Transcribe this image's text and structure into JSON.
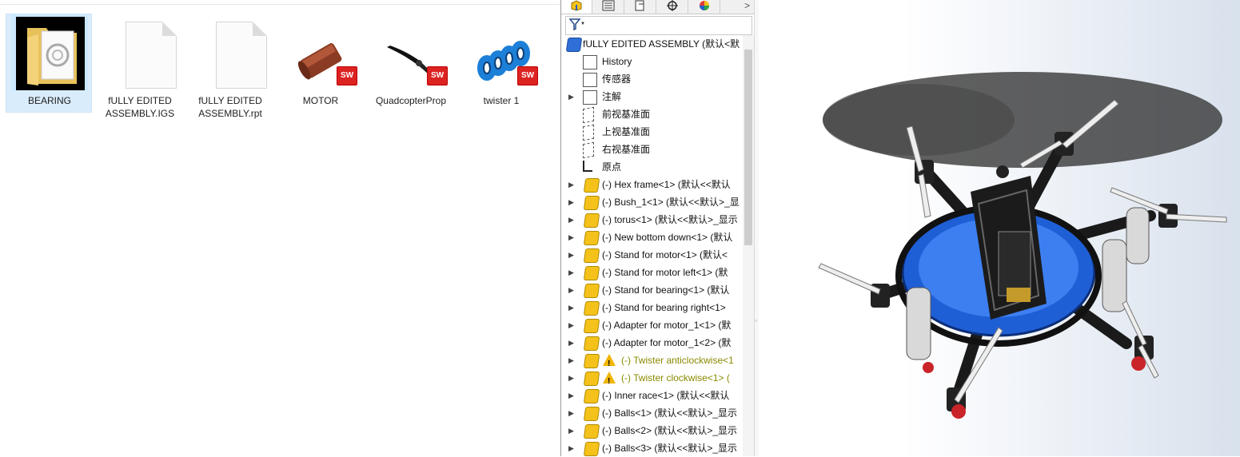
{
  "explorer": {
    "files": [
      {
        "name": "BEARING",
        "type": "folder"
      },
      {
        "name": "fULLY EDITED ASSEMBLY.IGS",
        "type": "document"
      },
      {
        "name": "fULLY EDITED ASSEMBLY.rpt",
        "type": "document"
      },
      {
        "name": "MOTOR",
        "type": "solidworks-part"
      },
      {
        "name": "QuadcopterProp",
        "type": "solidworks-part"
      },
      {
        "name": "twister 1",
        "type": "solidworks-part"
      }
    ],
    "sw_badge": "SW"
  },
  "feature_manager": {
    "tabs": [
      "featuremanager-icon",
      "propertymanager-icon",
      "configurationmanager-icon",
      "dimxpert-icon",
      "display-manager-icon"
    ],
    "more_glyph": ">",
    "filter_glyph": "▼",
    "root": "fULLY EDITED ASSEMBLY  (默认<默",
    "nodes": [
      {
        "label": "History",
        "icon": "history-icon",
        "expandable": false
      },
      {
        "label": "传感器",
        "icon": "sensor-icon",
        "expandable": false
      },
      {
        "label": "注解",
        "icon": "annotation-icon",
        "expandable": true
      },
      {
        "label": "前视基准面",
        "icon": "plane-icon",
        "expandable": false
      },
      {
        "label": "上视基准面",
        "icon": "plane-icon",
        "expandable": false
      },
      {
        "label": "右视基准面",
        "icon": "plane-icon",
        "expandable": false
      },
      {
        "label": "原点",
        "icon": "origin-icon",
        "expandable": false
      },
      {
        "label": "(-) Hex frame<1> (默认<<默认",
        "icon": "part-icon",
        "expandable": true
      },
      {
        "label": "(-) Bush_1<1> (默认<<默认>_显",
        "icon": "part-icon",
        "expandable": true
      },
      {
        "label": "(-) torus<1> (默认<<默认>_显示",
        "icon": "part-icon",
        "expandable": true
      },
      {
        "label": "(-) New bottom down<1> (默认",
        "icon": "part-icon",
        "expandable": true
      },
      {
        "label": "(-) Stand for motor<1> (默认<",
        "icon": "part-icon",
        "expandable": true
      },
      {
        "label": "(-) Stand for motor left<1> (默",
        "icon": "part-icon",
        "expandable": true
      },
      {
        "label": "(-) Stand for bearing<1> (默认",
        "icon": "part-icon",
        "expandable": true
      },
      {
        "label": "(-) Stand for bearing right<1>",
        "icon": "part-icon",
        "expandable": true
      },
      {
        "label": "(-) Adapter for motor_1<1> (默",
        "icon": "part-icon",
        "expandable": true
      },
      {
        "label": "(-) Adapter for motor_1<2> (默",
        "icon": "part-icon",
        "expandable": true
      },
      {
        "label": "(-) Twister anticlockwise<1",
        "icon": "warning-icon",
        "expandable": true,
        "warning": true
      },
      {
        "label": "(-) Twister clockwise<1> (",
        "icon": "warning-icon",
        "expandable": true,
        "warning": true
      },
      {
        "label": "(-) Inner race<1> (默认<<默认",
        "icon": "part-icon",
        "expandable": true
      },
      {
        "label": "(-) Balls<1> (默认<<默认>_显示",
        "icon": "part-icon",
        "expandable": true
      },
      {
        "label": "(-) Balls<2> (默认<<默认>_显示",
        "icon": "part-icon",
        "expandable": true
      },
      {
        "label": "(-) Balls<3> (默认<<默认>_显示",
        "icon": "part-icon",
        "expandable": true
      }
    ]
  },
  "splitter_glyph": "◦",
  "viewport": {
    "model": "hexacopter-assembly",
    "colors": {
      "torus": "#1f5fd6",
      "frame": "#1a1a1a",
      "prop": "#e8e8e8",
      "motor": "#c9242a"
    }
  }
}
